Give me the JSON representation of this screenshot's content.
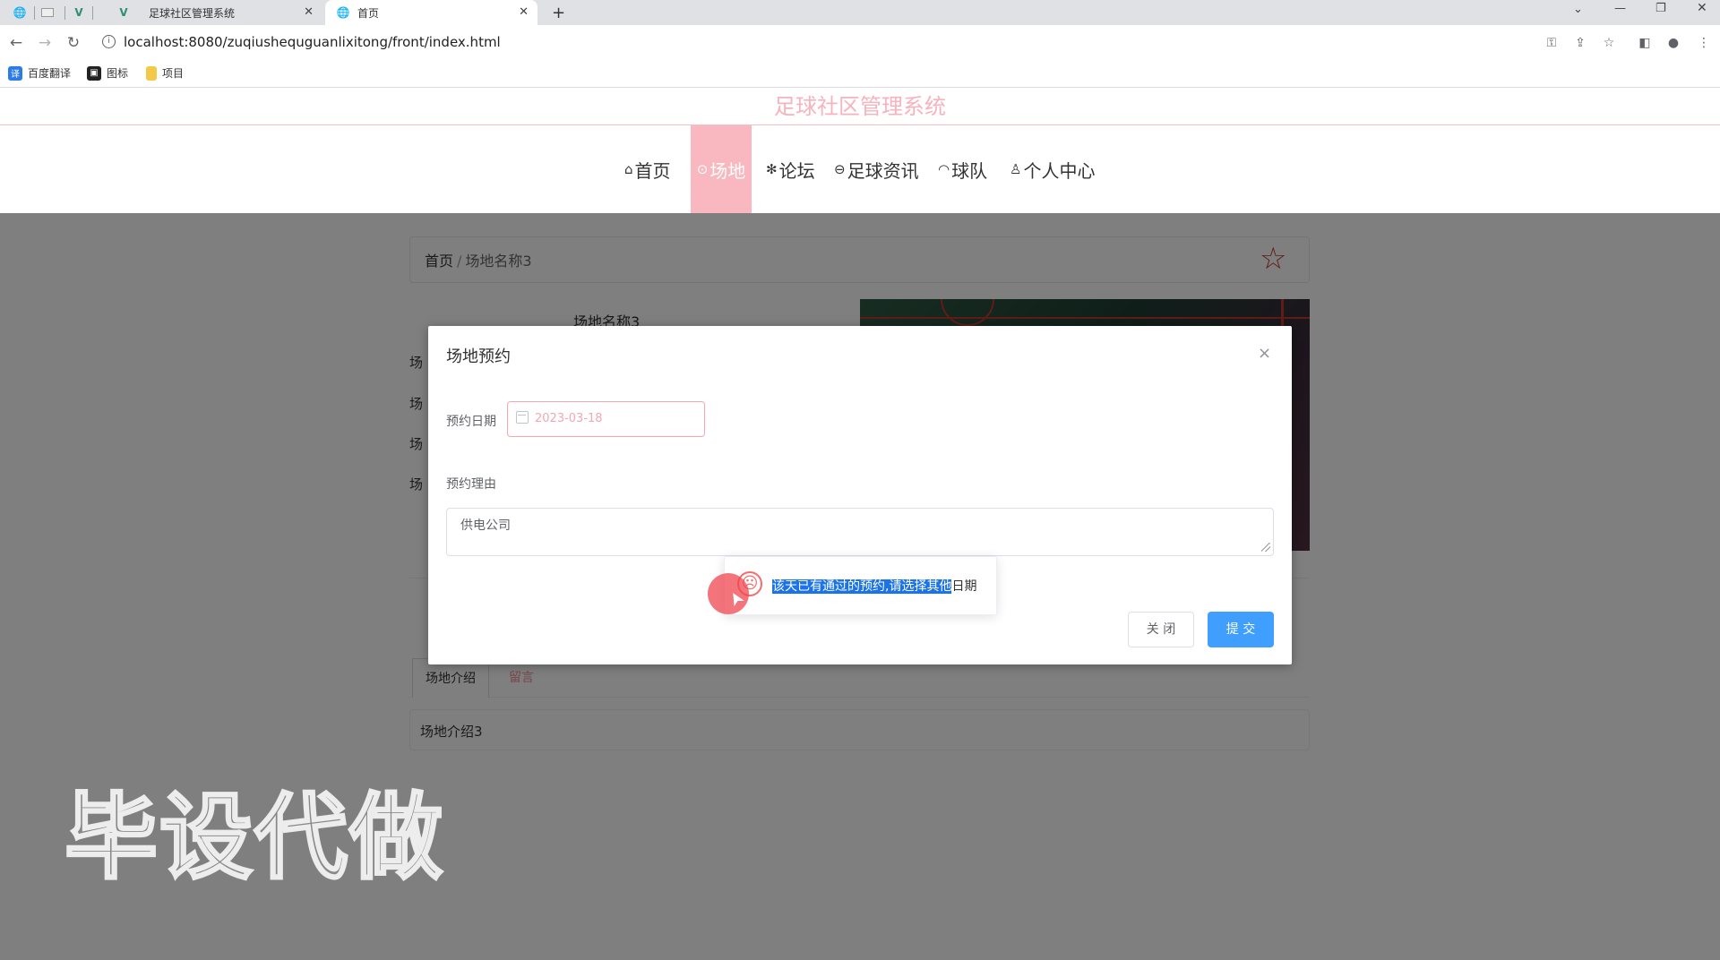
{
  "browser": {
    "tabs": [
      {
        "label": "足球社区管理系统",
        "active": false
      },
      {
        "label": "首页",
        "active": true
      }
    ],
    "new_tab": "+",
    "url": "localhost:8080/zuqiushequguanlixitong/front/index.html",
    "bookmarks": [
      {
        "label": "百度翻译",
        "icon": "translate-icon",
        "color": "#2b7bea"
      },
      {
        "label": "图标",
        "icon": "image-icon",
        "color": "#222222"
      },
      {
        "label": "项目",
        "icon": "folder-icon",
        "color": "#f3c948"
      }
    ]
  },
  "site": {
    "title": "足球社区管理系统",
    "nav": [
      {
        "label": "首页",
        "icon": "home-icon",
        "active": false
      },
      {
        "label": "场地",
        "icon": "venue-icon",
        "active": true
      },
      {
        "label": "论坛",
        "icon": "forum-icon",
        "active": false
      },
      {
        "label": "足球资讯",
        "icon": "news-icon",
        "active": false
      },
      {
        "label": "球队",
        "icon": "team-icon",
        "active": false
      },
      {
        "label": "个人中心",
        "icon": "user-icon",
        "active": false
      }
    ],
    "accent_color": "#f9b8c0"
  },
  "page": {
    "breadcrumb": {
      "home": "首页",
      "separator": "/",
      "current": "场地名称3"
    },
    "venue_name": "场地名称3",
    "field_labels": [
      "场",
      "场",
      "场",
      "场"
    ],
    "tabs": [
      {
        "label": "场地介绍",
        "active": true
      },
      {
        "label": "留言",
        "active": false
      }
    ],
    "intro_text": "场地介绍3"
  },
  "dialog": {
    "title": "场地预约",
    "close": "×",
    "date_label": "预约日期",
    "date_value": "2023-03-18",
    "reason_label": "预约理由",
    "reason_value": "供电公司",
    "toast": {
      "icon": "sad-face-icon",
      "selected_text": "该天已有通过的预约,请选择其他",
      "rest_text": "日期",
      "color": "#f56c6c"
    },
    "close_button": "关 闭",
    "submit_button": "提 交",
    "submit_color": "#409eff"
  },
  "watermark": "毕设代做"
}
